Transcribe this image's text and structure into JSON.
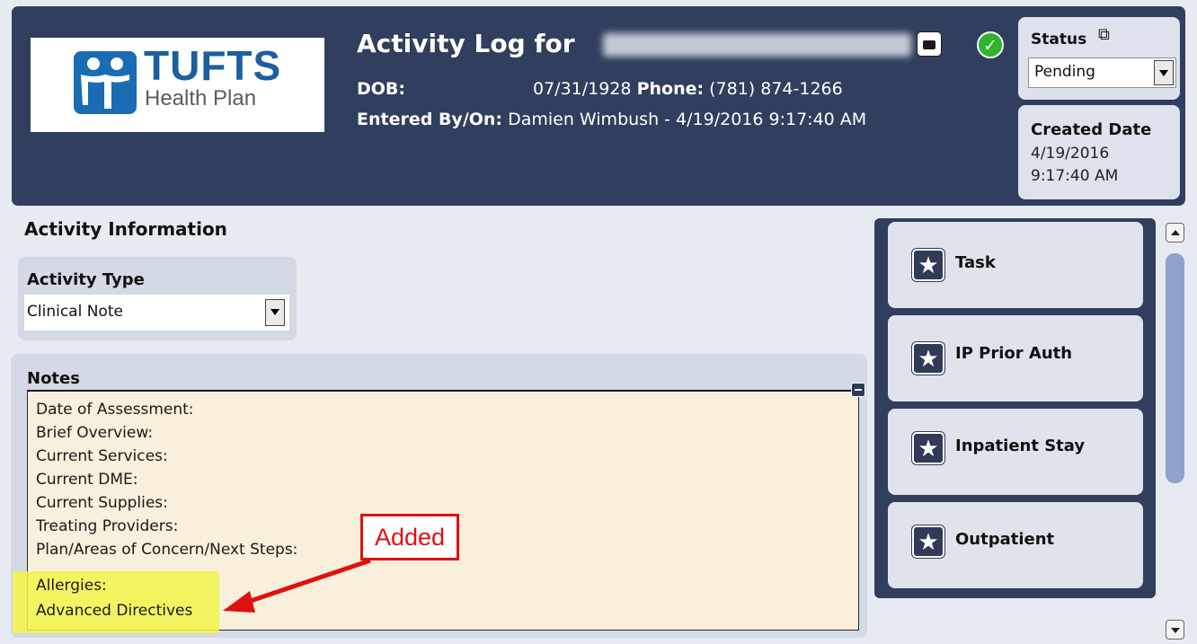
{
  "header": {
    "logo": {
      "word": "TUFTS",
      "sub": "Health Plan"
    },
    "title_prefix": "Activity Log for",
    "dob_label": "DOB:",
    "dob": "07/31/1928",
    "phone_label": "Phone:",
    "phone": "(781) 874-1266",
    "entered_label": "Entered By/On:",
    "entered_value": "Damien Wimbush - 4/19/2016 9:17:40 AM",
    "icons": [
      "briefcase-icon",
      "checkmark-icon"
    ]
  },
  "status": {
    "label": "Status",
    "value": "Pending"
  },
  "created": {
    "label": "Created Date",
    "date": "4/19/2016",
    "time": "9:17:40 AM"
  },
  "activity": {
    "section_title": "Activity Information",
    "type_label": "Activity Type",
    "type_value": "Clinical Note"
  },
  "notes": {
    "label": "Notes",
    "lines": [
      "Date of Assessment:",
      "Brief Overview:",
      "Current Services:",
      "Current DME:",
      "Current Supplies:",
      "Treating Providers:",
      "Plan/Areas of Concern/Next Steps:",
      "Allergies:",
      "Advanced Directives"
    ],
    "highlight_color": "#f3f54a"
  },
  "annotation": {
    "label": "Added",
    "color": "#e01010"
  },
  "actions": [
    {
      "label": "Task"
    },
    {
      "label": "IP Prior Auth"
    },
    {
      "label": "Inpatient Stay"
    },
    {
      "label": "Outpatient"
    }
  ],
  "colors": {
    "header_bg": "#313e5e",
    "brand_blue": "#1b5fa0",
    "notes_bg": "#f8efdc"
  }
}
